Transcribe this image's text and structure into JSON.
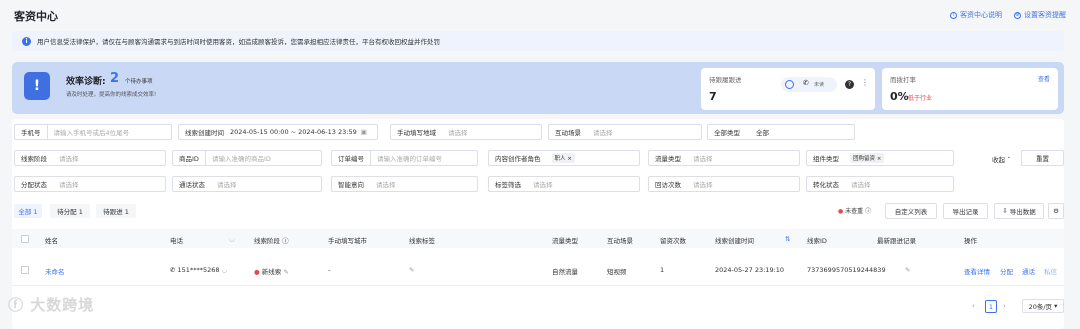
{
  "page_title": "客资中心",
  "top_links": {
    "help": "客资中心说明",
    "settings": "设置客资提醒"
  },
  "notice": "用户信息受法律保护，请仅在与顾客沟通需求与到店时间时使用客资，如造成顾客投诉，您需承担相应法律责任，平台有权收回权益并作处罚",
  "diagnosis": {
    "title": "效率诊断:",
    "count": "2",
    "count_label": "个待办事项",
    "desc": "请及时处理，提高你的线索成交效率!"
  },
  "card_pending": {
    "label": "待跟履跟进",
    "value": "7",
    "chip_label": "未读"
  },
  "card_rate": {
    "label": "而拨打率",
    "link": "查看",
    "value": "0%",
    "badge": "低于行业"
  },
  "filters": {
    "phone": {
      "label": "手机号",
      "placeholder": "请输入手机号或后4位尾号"
    },
    "created": {
      "label": "线索创建时间",
      "value": "2024-05-15 00:00 ~ 2024-06-13 23:59"
    },
    "city": {
      "label": "手动填写地域",
      "placeholder": "请选择"
    },
    "scene": {
      "label": "互动场景",
      "placeholder": "请选择"
    },
    "type": {
      "label": "全部类型",
      "value": "全部"
    },
    "stage": {
      "label": "线索阶段",
      "placeholder": "请选择"
    },
    "product": {
      "label": "商品ID",
      "placeholder": "请输入准确的商品ID"
    },
    "order": {
      "label": "订单编号",
      "placeholder": "请输入准确的订单编号"
    },
    "creator": {
      "label": "内容创作者角色",
      "tag": "职人"
    },
    "flow": {
      "label": "流量类型",
      "placeholder": "请选择"
    },
    "component": {
      "label": "组件类型",
      "tag": "团购留资"
    },
    "assign": {
      "label": "分配状态",
      "placeholder": "请选择"
    },
    "call": {
      "label": "通话状态",
      "placeholder": "请选择"
    },
    "intent": {
      "label": "智能意向",
      "placeholder": "请选择"
    },
    "label_filter": {
      "label": "标签筛选",
      "placeholder": "请选择"
    },
    "visits": {
      "label": "回访次数",
      "placeholder": "请选择"
    },
    "convert": {
      "label": "转化状态",
      "placeholder": "请选择"
    },
    "collapse": "收起",
    "reset": "重置"
  },
  "tabs": [
    {
      "label": "全部 1"
    },
    {
      "label": "待分配 1"
    },
    {
      "label": "待跟进 1"
    }
  ],
  "toolbar": {
    "unread": "未查重",
    "custom_columns": "自定义列表",
    "export_log": "导出记录",
    "export_data": "导出数据"
  },
  "columns": [
    "姓名",
    "电话",
    "线索阶段",
    "手动填写城市",
    "线索标签",
    "流量类型",
    "互动场景",
    "留资次数",
    "线索创建时间",
    "线索ID",
    "最新跟进记录",
    "操作"
  ],
  "row": {
    "name": "未命名",
    "phone": "151****5268",
    "stage": "新线索",
    "city": "-",
    "flow": "自然流量",
    "scene": "短视频",
    "count": "1",
    "created": "2024-05-27 23:19:10",
    "id": "7373699570519244839",
    "actions": [
      "查看详情",
      "分配",
      "通话",
      "私信"
    ]
  },
  "pagination": {
    "page": "1",
    "size": "20条/页"
  },
  "watermark": "大数跨境",
  "colors": {
    "accent": "#3b72f0",
    "danger": "#e5484d"
  }
}
